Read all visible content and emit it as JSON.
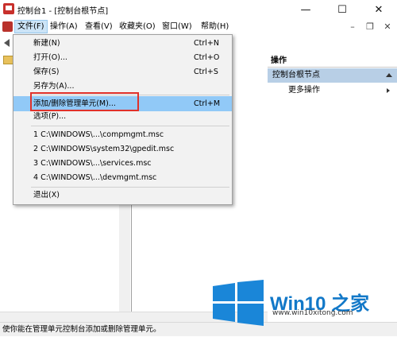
{
  "window": {
    "title": "控制台1 - [控制台根节点]",
    "controls": {
      "minimize": "—",
      "maximize": "☐",
      "close": "✕"
    },
    "mdi_controls": {
      "minimize": "–",
      "restore": "❐",
      "close": "✕"
    }
  },
  "menubar": {
    "items": [
      "文件(F)",
      "操作(A)",
      "查看(V)",
      "收藏夹(O)",
      "窗口(W)",
      "帮助(H)"
    ]
  },
  "file_menu": {
    "new": {
      "label": "新建(N)",
      "shortcut": "Ctrl+N"
    },
    "open": {
      "label": "打开(O)...",
      "shortcut": "Ctrl+O"
    },
    "save": {
      "label": "保存(S)",
      "shortcut": "Ctrl+S"
    },
    "save_as": {
      "label": "另存为(A)..."
    },
    "add_remove": {
      "label": "添加/删除管理单元(M)...",
      "shortcut": "Ctrl+M"
    },
    "options": {
      "label": "选项(P)..."
    },
    "recent": [
      "1 C:\\WINDOWS\\...\\compmgmt.msc",
      "2 C:\\WINDOWS\\system32\\gpedit.msc",
      "3 C:\\WINDOWS\\...\\services.msc",
      "4 C:\\WINDOWS\\...\\devmgmt.msc"
    ],
    "exit": {
      "label": "退出(X)"
    }
  },
  "actions_pane": {
    "header": "操作",
    "section": "控制台根节点",
    "more": "更多操作"
  },
  "status": {
    "text": "使你能在管理单元控制台添加或删除管理单元。"
  },
  "watermark": {
    "brand": "Win10 之家",
    "url": "www.win10xitong.com"
  },
  "colors": {
    "highlight": "#91c9f7",
    "annotation_box": "#e0312a",
    "brand_blue": "#1278c8"
  }
}
